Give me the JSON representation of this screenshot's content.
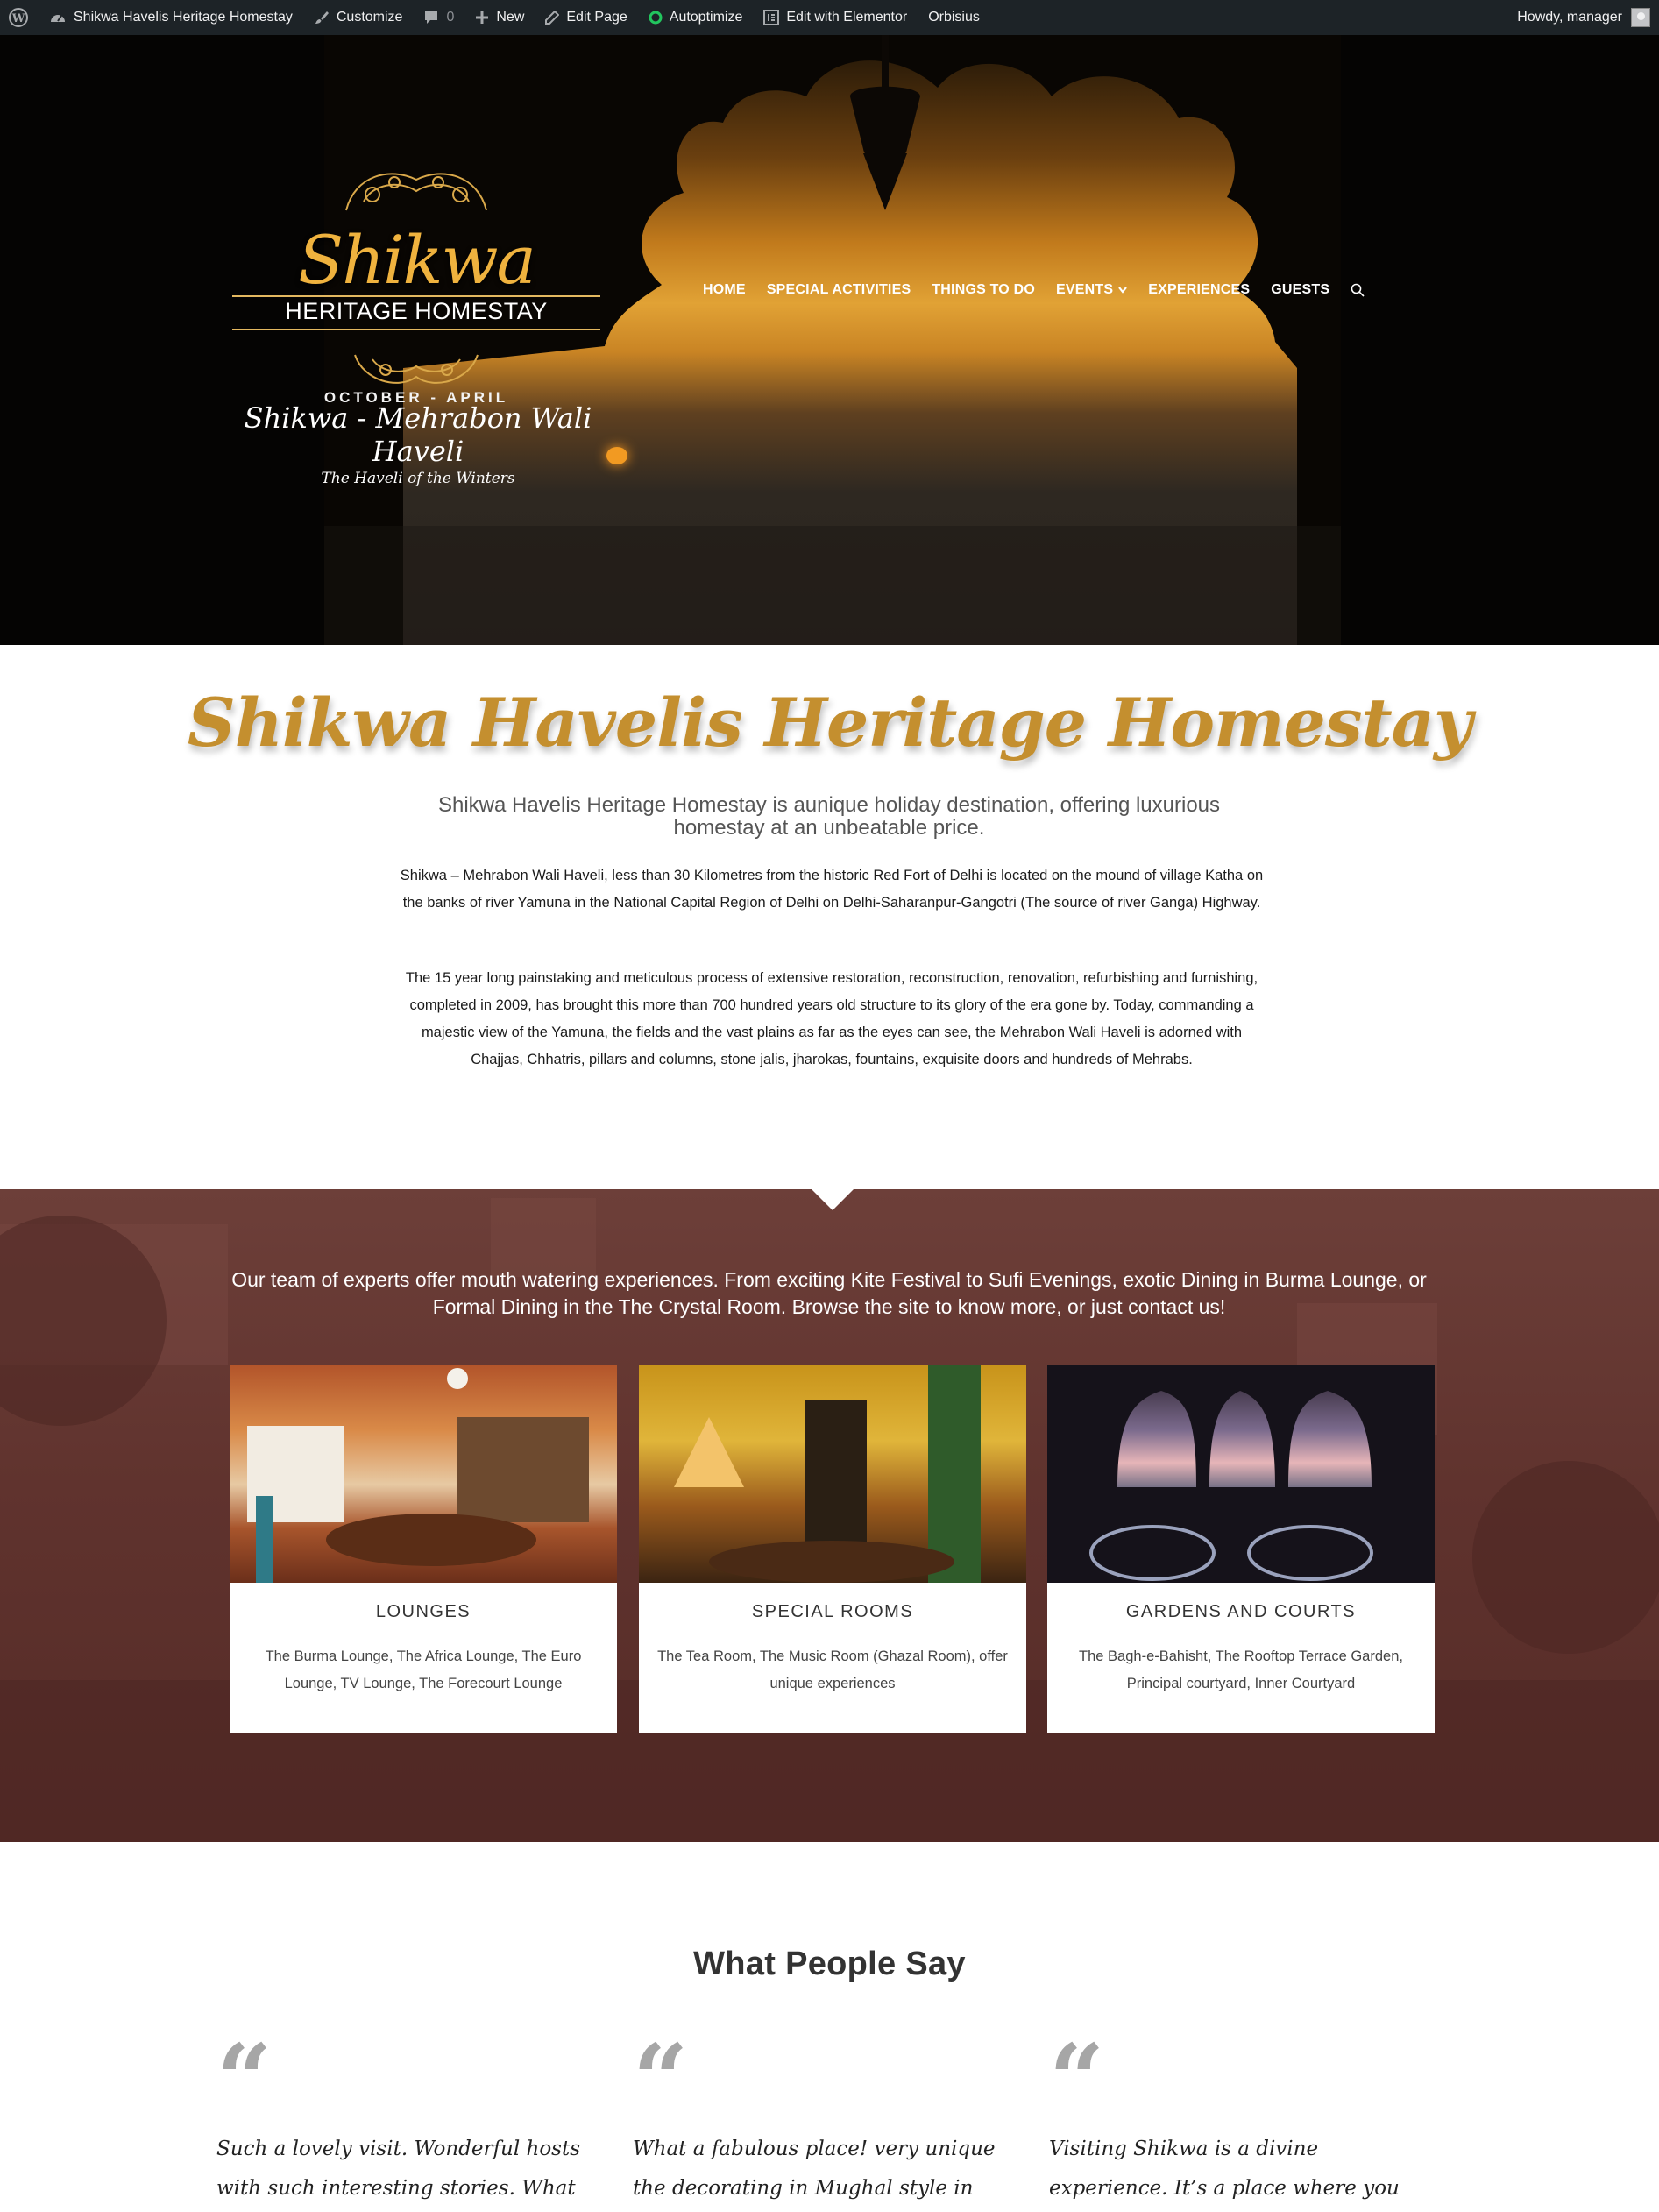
{
  "admin_bar": {
    "site_name": "Shikwa Havelis Heritage Homestay",
    "customize": "Customize",
    "comments": "0",
    "new": "New",
    "edit_page": "Edit Page",
    "autoptimize": "Autoptimize",
    "edit_elementor": "Edit with Elementor",
    "orbisius": "Orbisius",
    "howdy": "Howdy, manager"
  },
  "hero": {
    "logo_script": "Shikwa",
    "logo_sub": "HERITAGE HOMESTAY",
    "logo_season": "OCTOBER - APRIL",
    "tagline_title": "Shikwa - Mehrabon Wali Haveli",
    "tagline_sub": "The Haveli of the Winters"
  },
  "nav": {
    "home": "HOME",
    "special_activities": "SPECIAL ACTIVITIES",
    "things_to_do": "THINGS TO DO",
    "events": "EVENTS",
    "experiences": "EXPERIENCES",
    "guests": "GUESTS"
  },
  "intro": {
    "title": "Shikwa Havelis Heritage Homestay",
    "lead": "Shikwa Havelis Heritage Homestay is aunique holiday destination, offering luxurious homestay at an unbeatable price.",
    "p1": "Shikwa – Mehrabon Wali Haveli, less than 30 Kilometres from the historic Red Fort of Delhi is located on the mound of village Katha on the banks of river Yamuna in the National Capital Region of Delhi on Delhi-Saharanpur-Gangotri (The source of river Ganga) Highway.",
    "p2": "The 15 year long painstaking and meticulous process of extensive restoration, reconstruction, renovation, refurbishing and furnishing, completed in 2009, has brought this more than 700 hundred years old structure to its glory of the era gone by. Today, commanding a majestic view of the Yamuna, the fields and the vast plains as far as the eyes can see, the Mehrabon Wali Haveli is adorned with Chajjas, Chhatris, pillars and columns, stone jalis, jharokas, fountains, exquisite doors and hundreds of Mehrabs."
  },
  "experiences": {
    "text": "Our team of experts offer mouth watering experiences. From exciting Kite Festival to Sufi Evenings, exotic Dining in Burma Lounge, or Formal Dining in the The Crystal Room. Browse the site to know more, or just contact us!",
    "cards": [
      {
        "title": "LOUNGES",
        "desc": "The Burma Lounge, The Africa Lounge, The Euro Lounge, TV Lounge, The Forecourt Lounge"
      },
      {
        "title": "SPECIAL ROOMS",
        "desc": "The Tea Room, The Music Room (Ghazal Room), offer unique experiences"
      },
      {
        "title": "GARDENS AND COURTS",
        "desc": "The Bagh-e-Bahisht, The Rooftop Terrace Garden, Principal courtyard, Inner Courtyard"
      }
    ]
  },
  "testimonials": {
    "title": "What People Say",
    "quote_mark": "“",
    "items": [
      {
        "text": "Such a lovely visit. Wonderful hosts with such interesting stories. What a gorgeous Haveli... and the lunch!"
      },
      {
        "text": "What a fabulous place! very unique the decorating in Mughal style in wonderful, a lovely quiet area with"
      },
      {
        "text": "Visiting Shikwa is a divine experience. It’s a place where you get a chance to explore self. Shazia & Alka is an"
      }
    ]
  },
  "colors": {
    "admin_bar": "#1d2327",
    "title_gold": "#c48f2f",
    "band": "#60332e"
  }
}
